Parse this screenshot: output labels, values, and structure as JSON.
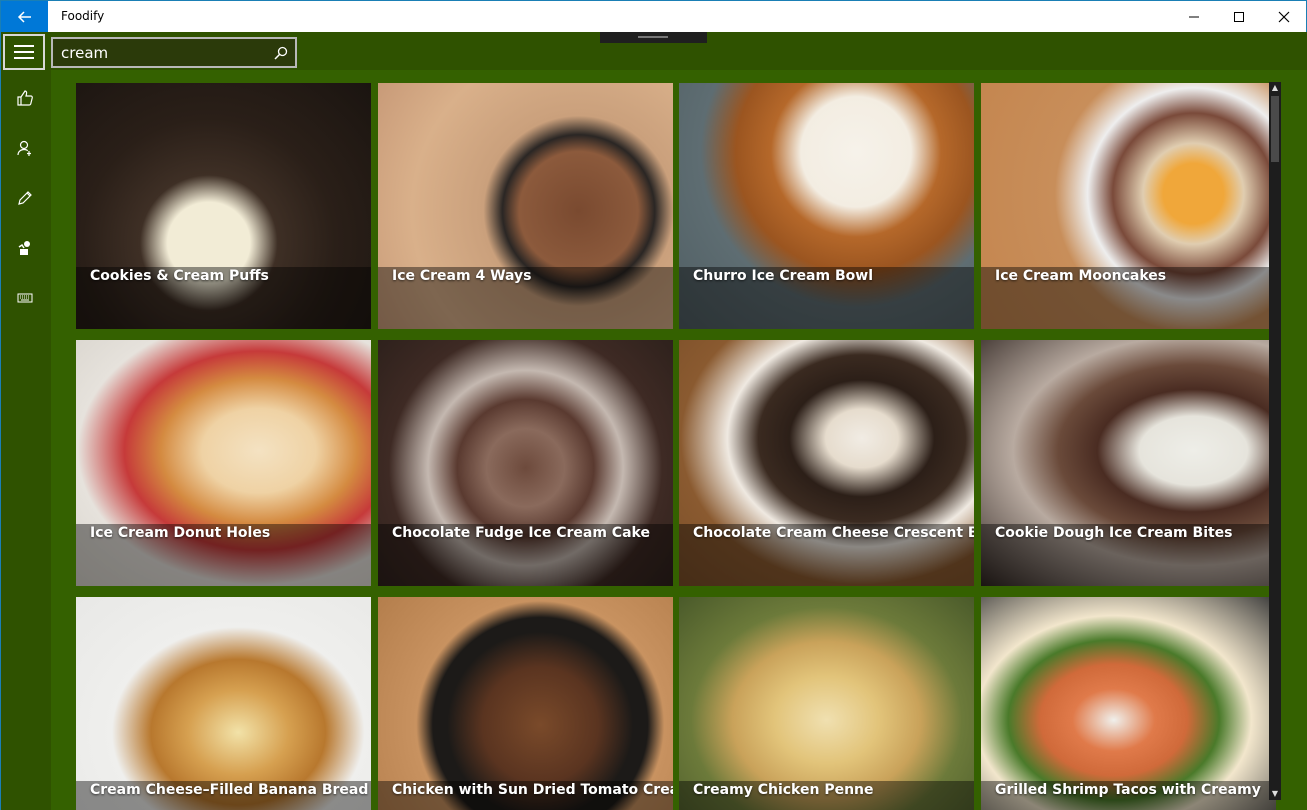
{
  "app": {
    "title": "Foodify"
  },
  "window_controls": {
    "minimize_icon": "minimize-icon",
    "maximize_icon": "maximize-icon",
    "close_icon": "close-icon"
  },
  "search": {
    "value": "cream",
    "placeholder": ""
  },
  "nav": [
    {
      "name": "nav-liked",
      "icon": "thumbs-up-icon"
    },
    {
      "name": "nav-profile",
      "icon": "person-icon"
    },
    {
      "name": "nav-edit",
      "icon": "pencil-icon"
    },
    {
      "name": "nav-chef",
      "icon": "chef-icon"
    },
    {
      "name": "nav-keyboard",
      "icon": "keyboard-icon"
    }
  ],
  "colors": {
    "accent": "#0078d7",
    "background": "#2f5200",
    "tile_border": "#346100"
  },
  "recipes": [
    {
      "title": "Cookies & Cream Puffs",
      "image": "cream-puff-photo"
    },
    {
      "title": "Ice Cream 4 Ways",
      "image": "chocolate-ice-cream-photo"
    },
    {
      "title": "Churro Ice Cream Bowl",
      "image": "churro-bowl-photo"
    },
    {
      "title": "Ice Cream Mooncakes",
      "image": "mooncake-photo"
    },
    {
      "title": "Ice Cream Donut Holes",
      "image": "donut-hole-photo"
    },
    {
      "title": "Chocolate Fudge Ice Cream Cake",
      "image": "fudge-cake-photo"
    },
    {
      "title": "Chocolate Cream Cheese Crescent Bake",
      "image": "crescent-bake-photo"
    },
    {
      "title": "Cookie Dough Ice Cream Bites",
      "image": "cookie-dough-bites-photo"
    },
    {
      "title": "Cream Cheese–Filled Banana Bread",
      "image": "banana-bread-photo"
    },
    {
      "title": "Chicken with Sun Dried Tomato Cream",
      "image": "skillet-chicken-photo"
    },
    {
      "title": "Creamy Chicken Penne",
      "image": "penne-photo"
    },
    {
      "title": "Grilled Shrimp Tacos with Creamy",
      "image": "shrimp-tacos-photo"
    }
  ]
}
